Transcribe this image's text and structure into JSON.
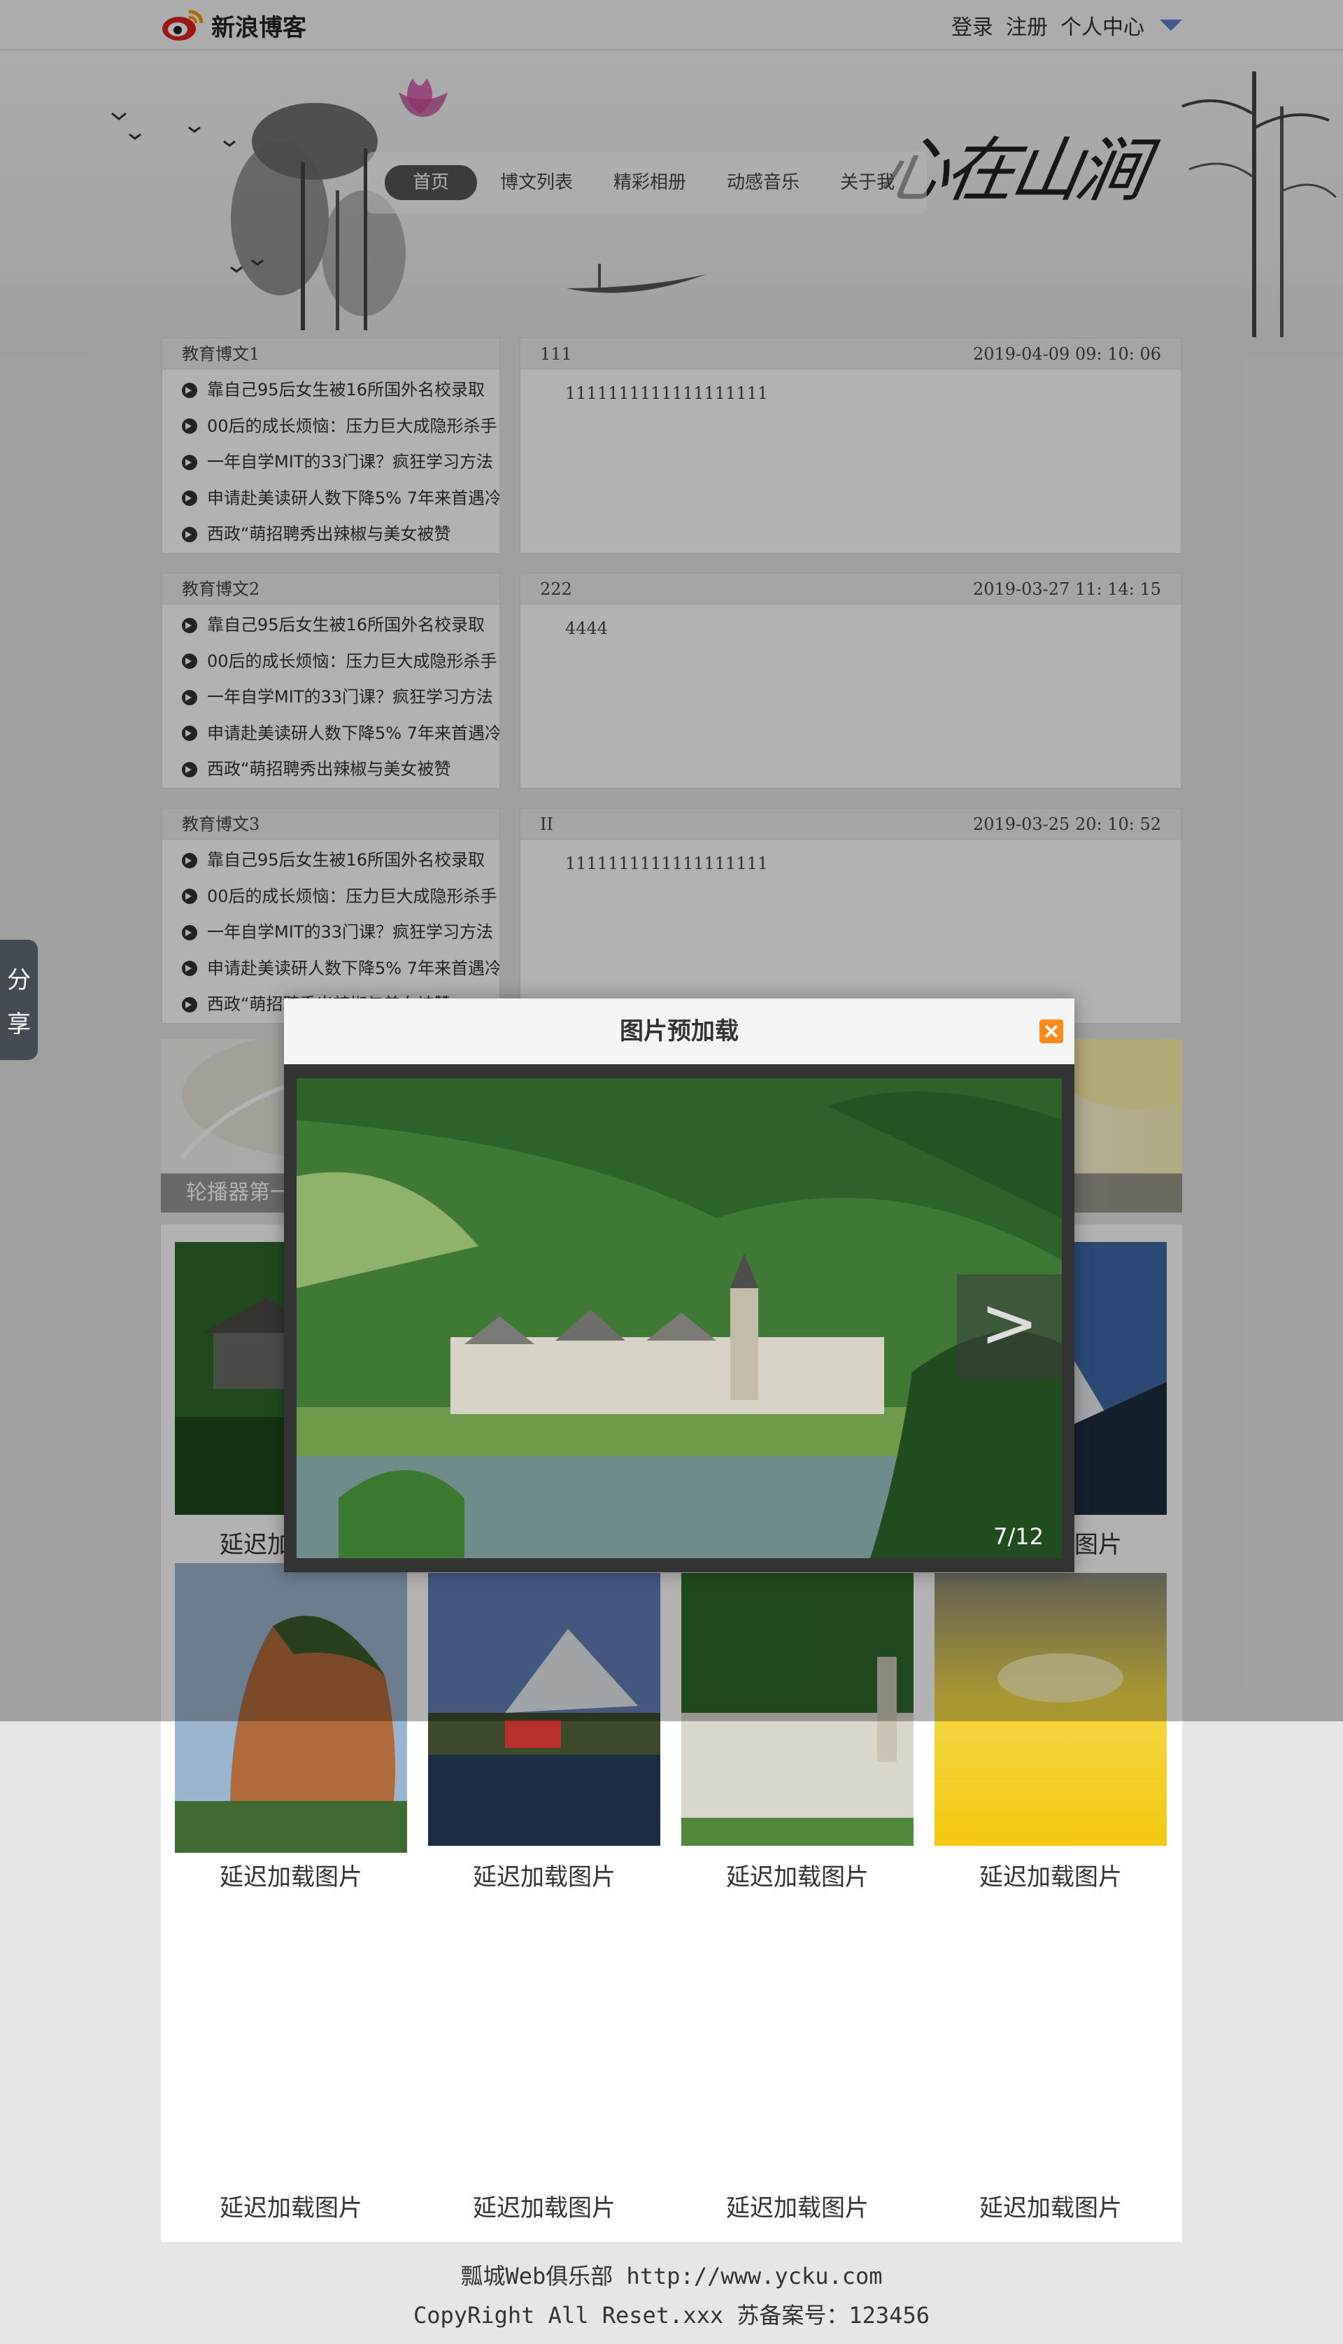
{
  "topbar": {
    "logo_text": "新浪博客",
    "login": "登录",
    "register": "注册",
    "personal_center": "个人中心"
  },
  "header": {
    "calligraphy": "心在山涧",
    "nav": [
      "首页",
      "博文列表",
      "精彩相册",
      "动感音乐",
      "关于我"
    ]
  },
  "blocks": [
    {
      "side_title": "教育博文1",
      "main_title": "111",
      "date": "2019-04-09 09: 10: 06",
      "content": "1111111111111111111"
    },
    {
      "side_title": "教育博文2",
      "main_title": "222",
      "date": "2019-03-27 11: 14: 15",
      "content": "4444"
    },
    {
      "side_title": "教育博文3",
      "main_title": "II",
      "date": "2019-03-25 20: 10: 52",
      "content": "1111111111111111111"
    }
  ],
  "side_links": [
    "靠自己95后女生被16所国外名校录取",
    "00后的成长烦恼：压力巨大成隐形杀手",
    "一年自学MIT的33门课？疯狂学习方法",
    "申请赴美读研人数下降5% 7年来首遇冷",
    "西政“萌招聘秀出辣椒与美女被赞"
  ],
  "slider": {
    "caption": "轮播器第一张图片"
  },
  "gallery": {
    "caption": "延迟加载图片"
  },
  "share": [
    "分",
    "享"
  ],
  "modal": {
    "title": "图片预加载",
    "counter": "7/12",
    "next": ">"
  },
  "footer": {
    "line1": "瓢城Web俱乐部 http://www.ycku.com",
    "line2": "CopyRight All Reset.xxx 苏备案号：123456"
  },
  "colors": {
    "logo_red": "#e02020",
    "nav_active": "#555555",
    "close_orange": "#ff8a1a",
    "caret_blue": "#5a7fd0"
  }
}
